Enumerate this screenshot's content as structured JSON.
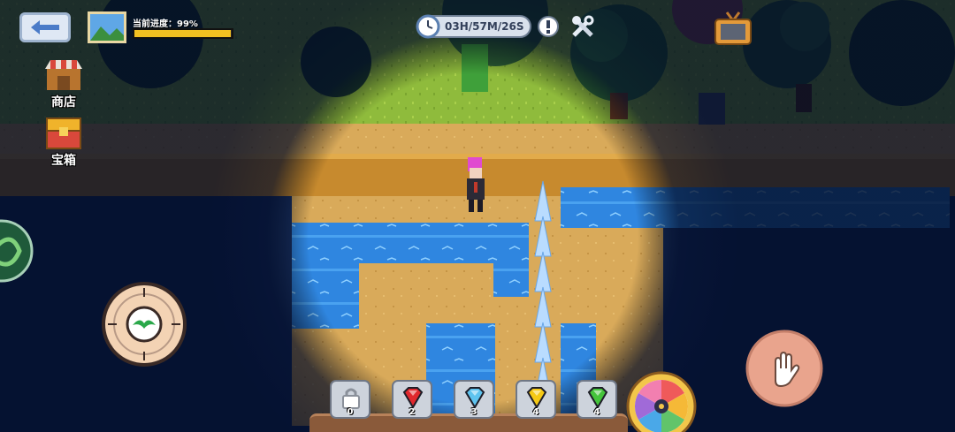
{
  "hud": {
    "progress_label": "当前进度：99%",
    "progress_value": 0.99,
    "timer": "03H/57M/26S",
    "accent_yellow": "#f2c021"
  },
  "side_buttons": [
    {
      "label": "商店",
      "icon": "shop-icon"
    },
    {
      "label": "宝箱",
      "icon": "treasure-chest-icon"
    }
  ],
  "inventory": [
    {
      "name": "locked-slot",
      "count": "0",
      "color": "#c9ccd2"
    },
    {
      "name": "red-gem",
      "count": "2",
      "color": "#e0282e"
    },
    {
      "name": "blue-gem",
      "count": "3",
      "color": "#5ec3ef"
    },
    {
      "name": "yellow-gem",
      "count": "4",
      "color": "#f5c915"
    },
    {
      "name": "green-gem",
      "count": "4",
      "color": "#45c43b"
    }
  ],
  "icons": {
    "back": "back-arrow-icon",
    "map": "map-thumbnail-icon",
    "clock": "clock-icon",
    "help": "help-icon",
    "tools": "tools-icon",
    "tv": "tv-icon",
    "move": "joystick-icon",
    "grab": "hand-icon",
    "wheel": "spin-wheel-icon"
  }
}
